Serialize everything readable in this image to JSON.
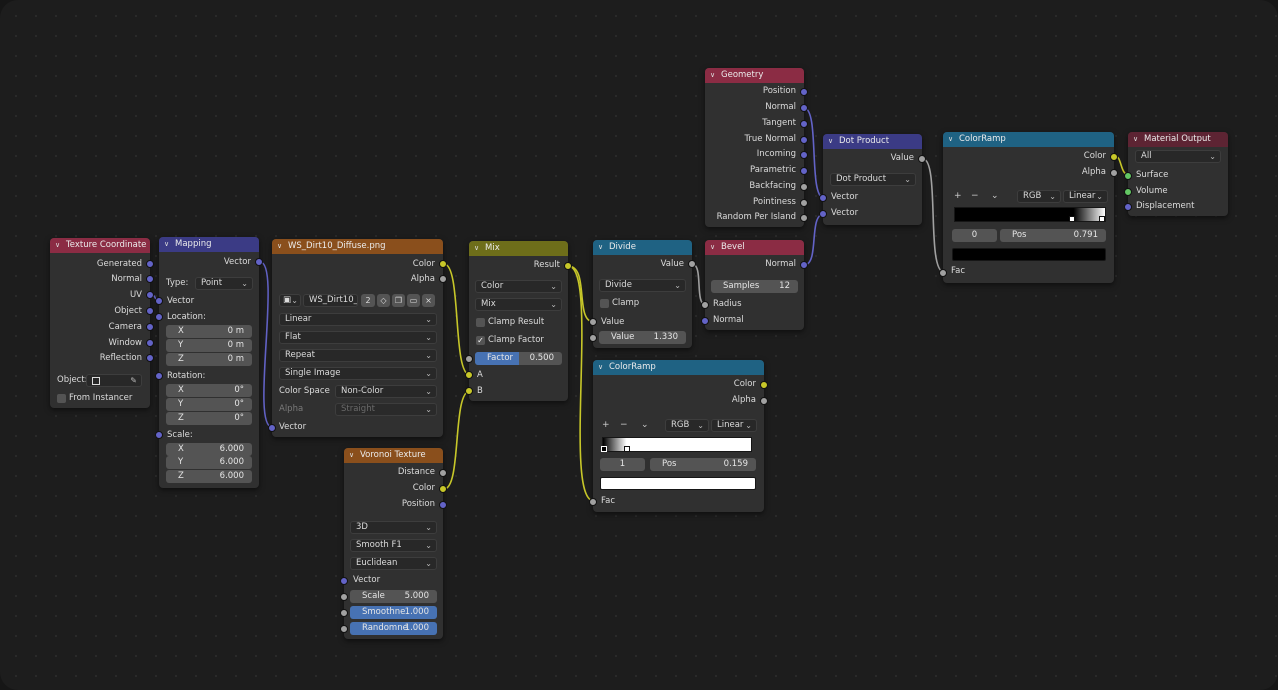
{
  "colors": {
    "input_header": "#8b2c44",
    "vector_header": "#3b3b85",
    "texture_header": "#8a4f1c",
    "color_header": "#6e6e1a",
    "converter_header": "#1f6283",
    "output_header": "#5d2433",
    "socket_vector": "#6363c7",
    "socket_color": "#c7c729",
    "socket_float": "#a1a1a1",
    "socket_shader": "#63c763",
    "field_blue": "#4772b3"
  },
  "texcoord": {
    "title": "Texture Coordinate",
    "outputs": [
      "Generated",
      "Normal",
      "UV",
      "Object",
      "Camera",
      "Window",
      "Reflection"
    ],
    "object_label": "Object:",
    "from_instancer": "From Instancer"
  },
  "mapping": {
    "title": "Mapping",
    "output": "Vector",
    "type_label": "Type:",
    "type_value": "Point",
    "vector_label": "Vector",
    "location_label": "Location:",
    "location": [
      {
        "axis": "X",
        "value": "0 m"
      },
      {
        "axis": "Y",
        "value": "0 m"
      },
      {
        "axis": "Z",
        "value": "0 m"
      }
    ],
    "rotation_label": "Rotation:",
    "rotation": [
      {
        "axis": "X",
        "value": "0°"
      },
      {
        "axis": "Y",
        "value": "0°"
      },
      {
        "axis": "Z",
        "value": "0°"
      }
    ],
    "scale_label": "Scale:",
    "scale": [
      {
        "axis": "X",
        "value": "6.000"
      },
      {
        "axis": "Y",
        "value": "6.000"
      },
      {
        "axis": "Z",
        "value": "6.000"
      }
    ]
  },
  "image": {
    "title": "WS_Dirt10_Diffuse.png",
    "out_color": "Color",
    "out_alpha": "Alpha",
    "image_name": "WS_Dirt10_...",
    "users": "2",
    "interpolation": "Linear",
    "projection": "Flat",
    "extension": "Repeat",
    "source": "Single Image",
    "color_space_label": "Color Space",
    "color_space": "Non-Color",
    "alpha_label": "Alpha",
    "alpha_value": "Straight",
    "input_vector": "Vector"
  },
  "voronoi": {
    "title": "Voronoi Texture",
    "outputs": [
      "Distance",
      "Color",
      "Position"
    ],
    "dimensions": "3D",
    "feature": "Smooth F1",
    "metric": "Euclidean",
    "vector_label": "Vector",
    "scale_label": "Scale",
    "scale_value": "5.000",
    "smooth_label": "Smoothne",
    "smooth_value": "1.000",
    "random_label": "Randomne",
    "random_value": "1.000"
  },
  "mix": {
    "title": "Mix",
    "output": "Result",
    "data_type": "Color",
    "blend": "Mix",
    "clamp_result": "Clamp Result",
    "clamp_factor": "Clamp Factor",
    "factor_label": "Factor",
    "factor_value": "0.500",
    "factor_fraction": 0.5,
    "input_a": "A",
    "input_b": "B"
  },
  "divide": {
    "title": "Divide",
    "output": "Value",
    "operation": "Divide",
    "clamp": "Clamp",
    "input_value": "Value",
    "value_label": "Value",
    "value_value": "1.330"
  },
  "ramp1": {
    "title": "ColorRamp",
    "out_color": "Color",
    "out_alpha": "Alpha",
    "plus": "+",
    "minus": "−",
    "mode": "RGB",
    "interp": "Linear",
    "index": "1",
    "pos_label": "Pos",
    "pos_value": "0.159",
    "input_fac": "Fac"
  },
  "geometry": {
    "title": "Geometry",
    "outputs": [
      "Position",
      "Normal",
      "Tangent",
      "True Normal",
      "Incoming",
      "Parametric",
      "Backfacing",
      "Pointiness",
      "Random Per Island"
    ]
  },
  "bevel": {
    "title": "Bevel",
    "output": "Normal",
    "samples_label": "Samples",
    "samples_value": "12",
    "input_radius": "Radius",
    "input_normal": "Normal"
  },
  "dot": {
    "title": "Dot Product",
    "output": "Value",
    "operation": "Dot Product",
    "input_1": "Vector",
    "input_2": "Vector"
  },
  "ramp2": {
    "title": "ColorRamp",
    "out_color": "Color",
    "out_alpha": "Alpha",
    "plus": "+",
    "minus": "−",
    "mode": "RGB",
    "interp": "Linear",
    "index": "0",
    "pos_label": "Pos",
    "pos_value": "0.791",
    "input_fac": "Fac"
  },
  "output": {
    "title": "Material Output",
    "target": "All",
    "inputs": [
      "Surface",
      "Volume",
      "Displacement"
    ]
  }
}
